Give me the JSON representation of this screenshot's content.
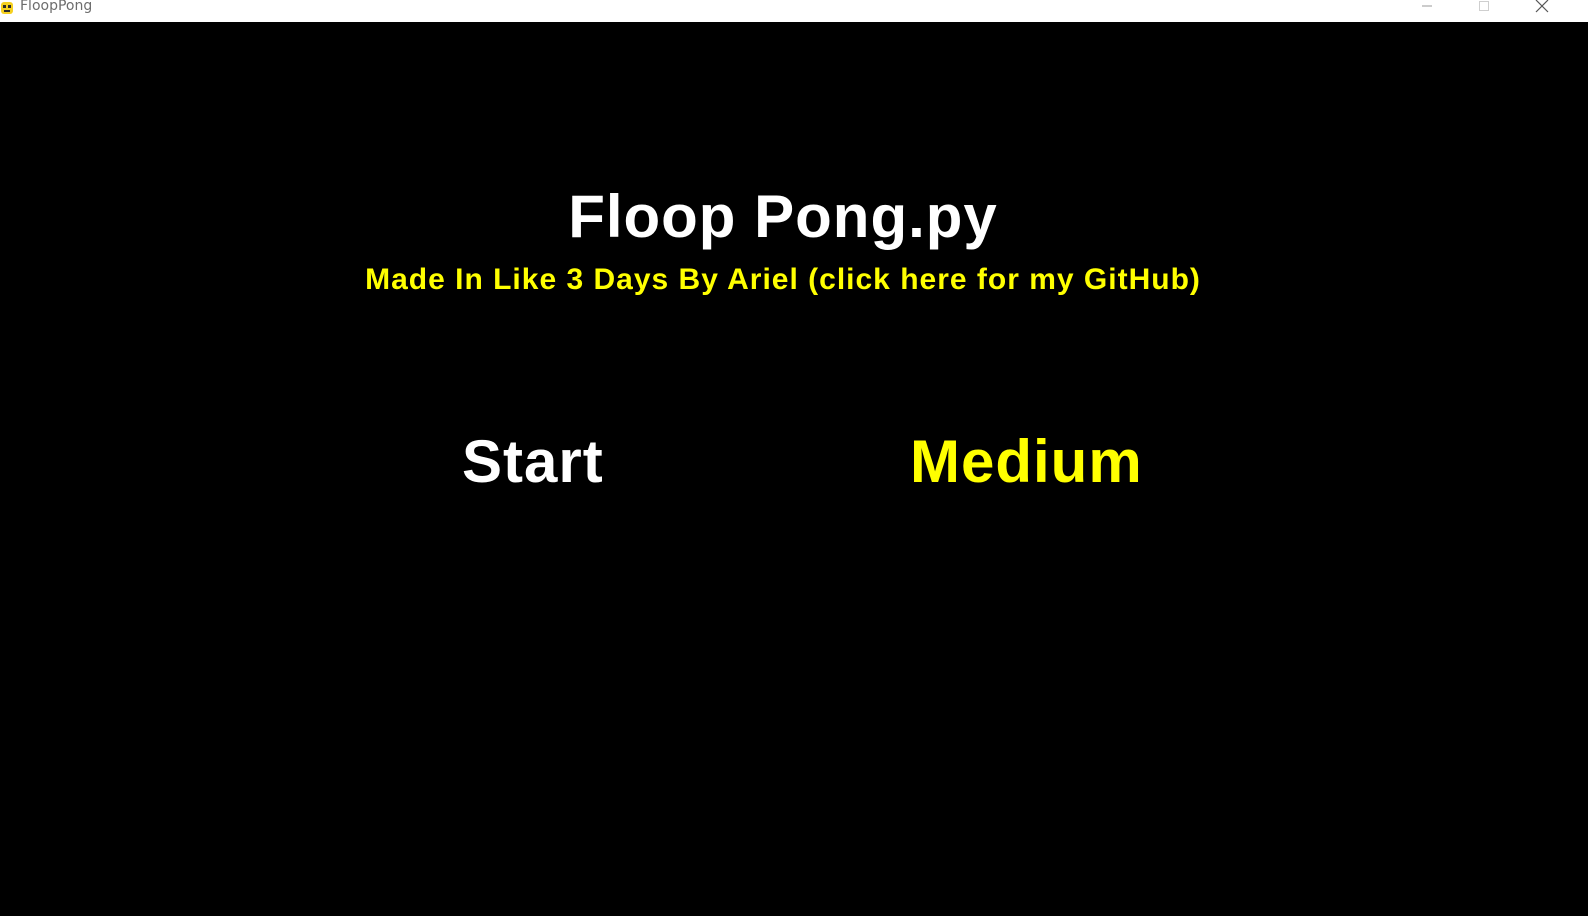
{
  "window": {
    "title": "FloopPong"
  },
  "menu": {
    "title": "Floop Pong.py",
    "credit": "Made In Like 3 Days By Ariel (click here for my GitHub)",
    "start_label": "Start",
    "difficulty_label": "Medium"
  },
  "colors": {
    "background": "#000000",
    "title": "#ffffff",
    "credit": "#ffff00",
    "difficulty": "#ffff00"
  },
  "icons": {
    "app": "pygame-snake-icon",
    "minimize": "minimize-icon",
    "maximize": "maximize-icon",
    "close": "close-icon"
  }
}
